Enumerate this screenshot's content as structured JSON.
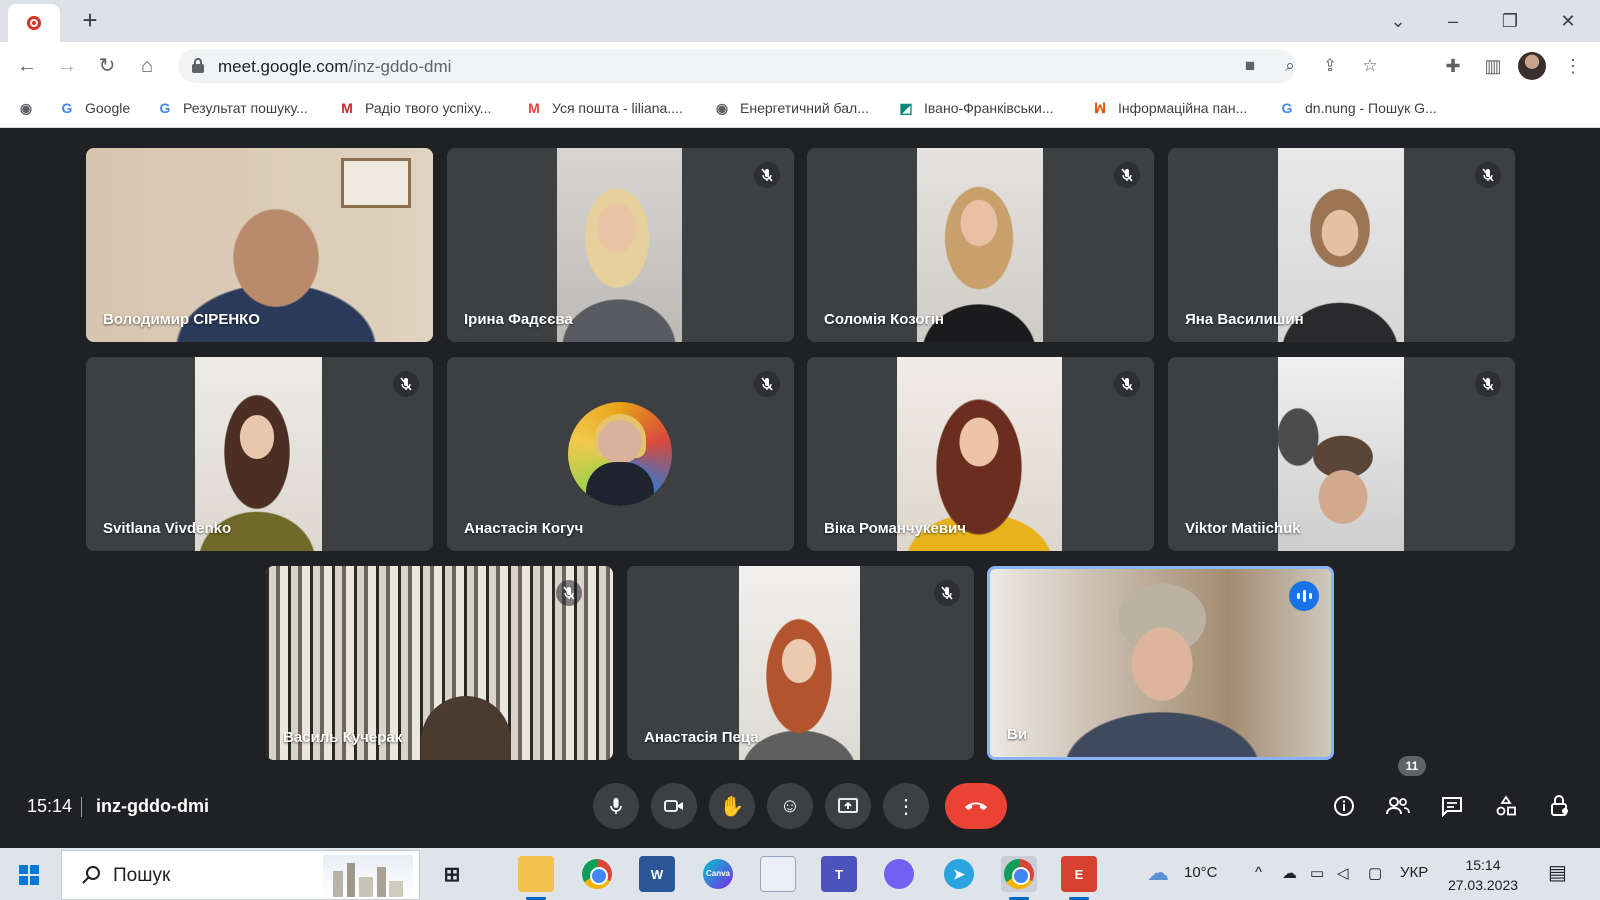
{
  "browser": {
    "url_host": "meet.google.com",
    "url_path": "/inz-gddo-dmi",
    "bookmarks": [
      {
        "label": "",
        "icon": "globe-icon"
      },
      {
        "label": "Google",
        "icon": "google-icon"
      },
      {
        "label": "Результат пошуку...",
        "icon": "google-icon"
      },
      {
        "label": "Радіо твого успіху...",
        "icon": "radio-icon"
      },
      {
        "label": "Уся пошта - liliana....",
        "icon": "gmail-icon"
      },
      {
        "label": "Енергетичний бал...",
        "icon": "globe-icon"
      },
      {
        "label": "Івано-Франківськи...",
        "icon": "map-icon"
      },
      {
        "label": "Інформаційна пан...",
        "icon": "info-panel-icon"
      },
      {
        "label": "dn.nung - Пошук G...",
        "icon": "google-icon"
      }
    ]
  },
  "participants": [
    {
      "name": "Володимир СІРЕНКО",
      "muted": false
    },
    {
      "name": "Ірина Фадєєва",
      "muted": true
    },
    {
      "name": "Соломія Козогін",
      "muted": true
    },
    {
      "name": "Яна Василишин",
      "muted": true
    },
    {
      "name": "Svitlana Vivdenko",
      "muted": true
    },
    {
      "name": "Анастасія Когуч",
      "muted": true
    },
    {
      "name": "Віка Романчукевич",
      "muted": true
    },
    {
      "name": "Viktor Matiichuk",
      "muted": true
    },
    {
      "name": "Василь Кучерак",
      "muted": true
    },
    {
      "name": "Анастасія Пеца",
      "muted": true
    },
    {
      "name": "Ви",
      "muted": false,
      "speaking": true
    }
  ],
  "meeting": {
    "time": "15:14",
    "code": "inz-gddo-dmi",
    "participant_count": "11"
  },
  "colors": {
    "background": "#202124",
    "tile": "#3c4043",
    "hangup": "#ea4335",
    "active_speaker": "#1a73e8"
  },
  "taskbar": {
    "search_placeholder": "Пошук",
    "weather": "10°C",
    "language": "УКР",
    "time": "15:14",
    "date": "27.03.2023"
  }
}
